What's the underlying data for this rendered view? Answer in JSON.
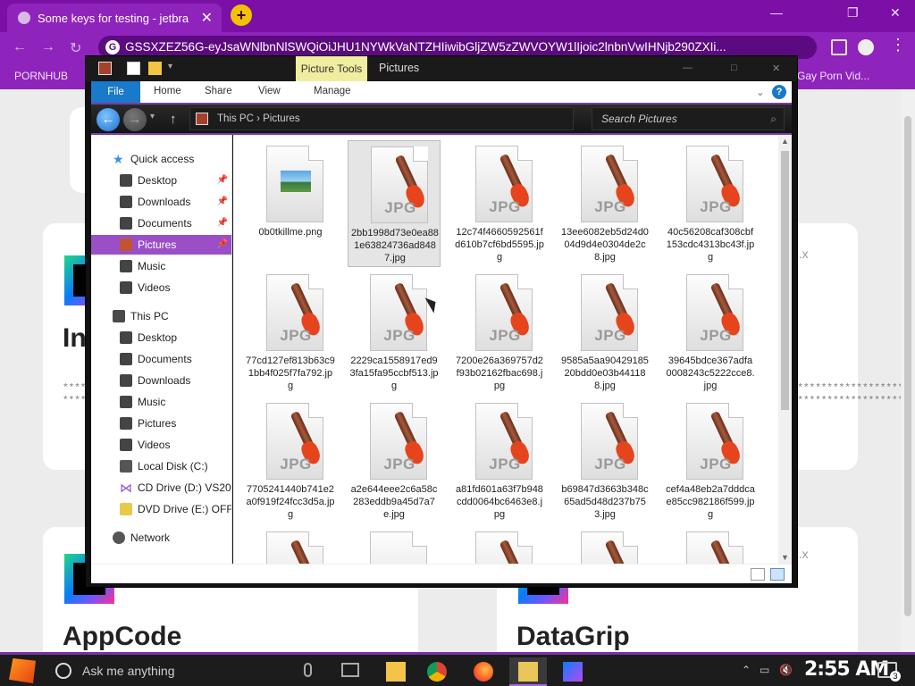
{
  "browser": {
    "tab_title": "Some keys for testing - jetbra",
    "tab_close": "✕",
    "new_tab": "+",
    "window_controls": [
      "—",
      "❐",
      "✕"
    ],
    "address": "GSSXZEZ56G-eyJsaWNlbnNlSWQiOiJHU1NYWkVaNTZHIiwibGljZW5zZWVOYW1lIjoic2lnbnVwIHNjb290ZXIi...",
    "bookmarks": [
      "PORNHUB",
      "Gay Porn Vid..."
    ]
  },
  "page": {
    "cards": [
      {
        "title": "In",
        "version": "2.x"
      },
      {
        "title": "AppCode",
        "version": ""
      },
      {
        "title": "DataGrip",
        "version": "2.x"
      }
    ],
    "stars": "******************************"
  },
  "explorer": {
    "context_tab": "Picture Tools",
    "window_title": "Pictures",
    "ribbon_tabs": [
      "File",
      "Home",
      "Share",
      "View",
      "Manage"
    ],
    "help": "?",
    "breadcrumbs": "This PC  ›  Pictures",
    "search_placeholder": "Search Pictures",
    "nav": {
      "quick_access": "Quick access",
      "quick_items": [
        "Desktop",
        "Downloads",
        "Documents",
        "Pictures",
        "Music",
        "Videos"
      ],
      "this_pc": "This PC",
      "pc_items": [
        "Desktop",
        "Documents",
        "Downloads",
        "Music",
        "Pictures",
        "Videos",
        "Local Disk (C:)",
        "CD Drive (D:) VS20:",
        "DVD Drive (E:) OFFI"
      ],
      "network": "Network"
    },
    "jpg_label": "JPG",
    "files": [
      "0b0tkillme.png",
      "2bb1998d73e0ea881e63824736ad8487.jpg",
      "12c74f4660592561fd610b7cf6bd5595.jpg",
      "13ee6082eb5d24d004d9d4e0304de2c8.jpg",
      "40c56208caf308cbf153cdc4313bc43f.jpg",
      "77cd127ef813b63c91bb4f025f7fa792.jpg",
      "2229ca1558917ed93fa15fa95ccbf513.jpg",
      "7200e26a369757d2f93b02162fbac698.jpg",
      "9585a5aa9042918520bdd0e03b441188.jpg",
      "39645bdce367adfa0008243c5222cce8.jpg",
      "7705241440b741e2a0f919f24fcc3d5a.jpg",
      "a2e644eee2c6a58c283eddb9a45d7a7e.jpg",
      "a81fd601a63f7b948cdd0064bc6463e8.jpg",
      "b69847d3663b348c65ad5d48d237b753.jpg",
      "cef4a48eb2a7dddcae85cc982186f599.jpg"
    ]
  },
  "taskbar": {
    "search_placeholder": "Ask me anything",
    "clock": "2:55 AM",
    "notification_count": "3"
  },
  "colors": {
    "browser_purple": "#8e24bb",
    "selection_purple": "#9b4fc6",
    "file_tab_blue": "#1979ca",
    "jpg_brush": "#e6441c"
  }
}
